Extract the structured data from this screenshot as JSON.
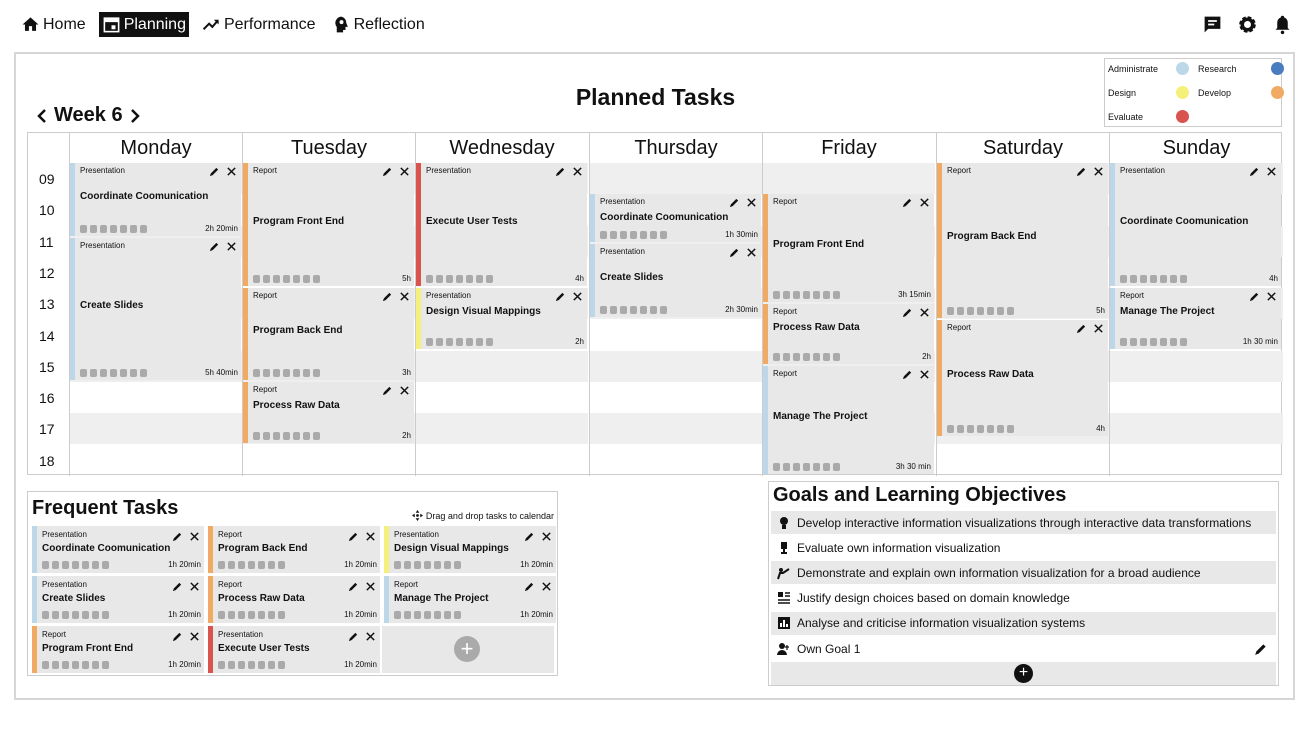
{
  "nav": {
    "home": "Home",
    "planning": "Planning",
    "performance": "Performance",
    "reflection": "Reflection"
  },
  "title": "Planned Tasks",
  "week": "Week 6",
  "legend": [
    {
      "label": "Administrate",
      "color": "#bcd8e8"
    },
    {
      "label": "Research",
      "color": "#4a7cc0"
    },
    {
      "label": "Design",
      "color": "#f5f07a"
    },
    {
      "label": "Develop",
      "color": "#f0aa64"
    },
    {
      "label": "Evaluate",
      "color": "#d9544f"
    }
  ],
  "hours": [
    "09",
    "10",
    "11",
    "12",
    "13",
    "14",
    "15",
    "16",
    "17",
    "18"
  ],
  "days": [
    "Monday",
    "Tuesday",
    "Wednesday",
    "Thursday",
    "Friday",
    "Saturday",
    "Sunday"
  ],
  "tasks": [
    {
      "day": 0,
      "start": 0,
      "len": 2.4,
      "type": "Presentation",
      "name": "Coordinate Coomunication",
      "dur": "2h 20min",
      "color": "#bcd8e8"
    },
    {
      "day": 0,
      "start": 2.4,
      "len": 4.6,
      "type": "Presentation",
      "name": "Create Slides",
      "dur": "5h 40min",
      "color": "#bcd8e8"
    },
    {
      "day": 1,
      "start": 0,
      "len": 4,
      "type": "Report",
      "name": "Program Front End",
      "dur": "5h",
      "color": "#f0aa64"
    },
    {
      "day": 1,
      "start": 4,
      "len": 3,
      "type": "Report",
      "name": "Program Back End",
      "dur": "3h",
      "color": "#f0aa64"
    },
    {
      "day": 1,
      "start": 7,
      "len": 2,
      "type": "Report",
      "name": "Process Raw Data",
      "dur": "2h",
      "color": "#f0aa64"
    },
    {
      "day": 2,
      "start": 0,
      "len": 4,
      "type": "Presentation",
      "name": "Execute User Tests",
      "dur": "4h",
      "color": "#d9544f"
    },
    {
      "day": 2,
      "start": 4,
      "len": 2,
      "type": "Presentation",
      "name": "Design Visual Mappings",
      "dur": "2h",
      "color": "#f5f07a"
    },
    {
      "day": 3,
      "start": 1,
      "len": 1.6,
      "type": "Presentation",
      "name": "Coordinate Coomunication",
      "dur": "1h 30min",
      "color": "#bcd8e8"
    },
    {
      "day": 3,
      "start": 2.6,
      "len": 2.4,
      "type": "Presentation",
      "name": "Create Slides",
      "dur": "2h 30min",
      "color": "#bcd8e8"
    },
    {
      "day": 4,
      "start": 1,
      "len": 3.5,
      "type": "Report",
      "name": "Program Front End",
      "dur": "3h 15min",
      "color": "#f0aa64"
    },
    {
      "day": 4,
      "start": 4.5,
      "len": 2,
      "type": "Report",
      "name": "Process Raw Data",
      "dur": "2h",
      "color": "#f0aa64"
    },
    {
      "day": 4,
      "start": 6.5,
      "len": 3.5,
      "type": "Report",
      "name": "Manage The Project",
      "dur": "3h 30 min",
      "color": "#bcd8e8"
    },
    {
      "day": 5,
      "start": 0,
      "len": 5,
      "type": "Report",
      "name": "Program Back End",
      "dur": "5h",
      "color": "#f0aa64"
    },
    {
      "day": 5,
      "start": 5,
      "len": 3.8,
      "type": "Report",
      "name": "Process Raw Data",
      "dur": "4h",
      "color": "#f0aa64"
    },
    {
      "day": 6,
      "start": 0,
      "len": 4,
      "type": "Presentation",
      "name": "Coordinate Coomunication",
      "dur": "4h",
      "color": "#bcd8e8"
    },
    {
      "day": 6,
      "start": 4,
      "len": 2,
      "type": "Report",
      "name": "Manage The Project",
      "dur": "1h 30 min",
      "color": "#bcd8e8"
    }
  ],
  "frequent": {
    "title": "Frequent Tasks",
    "hint": "Drag and drop tasks to calendar",
    "items": [
      {
        "type": "Presentation",
        "name": "Coordinate Coomunication",
        "dur": "1h 20min",
        "color": "#bcd8e8"
      },
      {
        "type": "Report",
        "name": "Program Back End",
        "dur": "1h 20min",
        "color": "#f0aa64"
      },
      {
        "type": "Presentation",
        "name": "Design Visual Mappings",
        "dur": "1h 20min",
        "color": "#f5f07a"
      },
      {
        "type": "Presentation",
        "name": "Create Slides",
        "dur": "1h 20min",
        "color": "#bcd8e8"
      },
      {
        "type": "Report",
        "name": "Process Raw Data",
        "dur": "1h 20min",
        "color": "#f0aa64"
      },
      {
        "type": "Report",
        "name": "Manage The Project",
        "dur": "1h 20min",
        "color": "#bcd8e8"
      },
      {
        "type": "Report",
        "name": "Program Front End",
        "dur": "1h 20min",
        "color": "#f0aa64"
      },
      {
        "type": "Presentation",
        "name": "Execute User Tests",
        "dur": "1h 20min",
        "color": "#d9544f"
      }
    ]
  },
  "goals": {
    "title": "Goals and Learning Objectives",
    "items": [
      {
        "text": "Develop interactive information visualizations through interactive data transformations",
        "icon": "bulb-icon"
      },
      {
        "text": "Evaluate own information visualization",
        "icon": "trophy-icon"
      },
      {
        "text": "Demonstrate and explain own information visualization for a broad audience",
        "icon": "present-icon"
      },
      {
        "text": "Justify design choices based on domain knowledge",
        "icon": "design-icon"
      },
      {
        "text": "Analyse and criticise information visualization systems",
        "icon": "chart-icon"
      },
      {
        "text": "Own Goal 1",
        "icon": "person-icon"
      }
    ]
  }
}
